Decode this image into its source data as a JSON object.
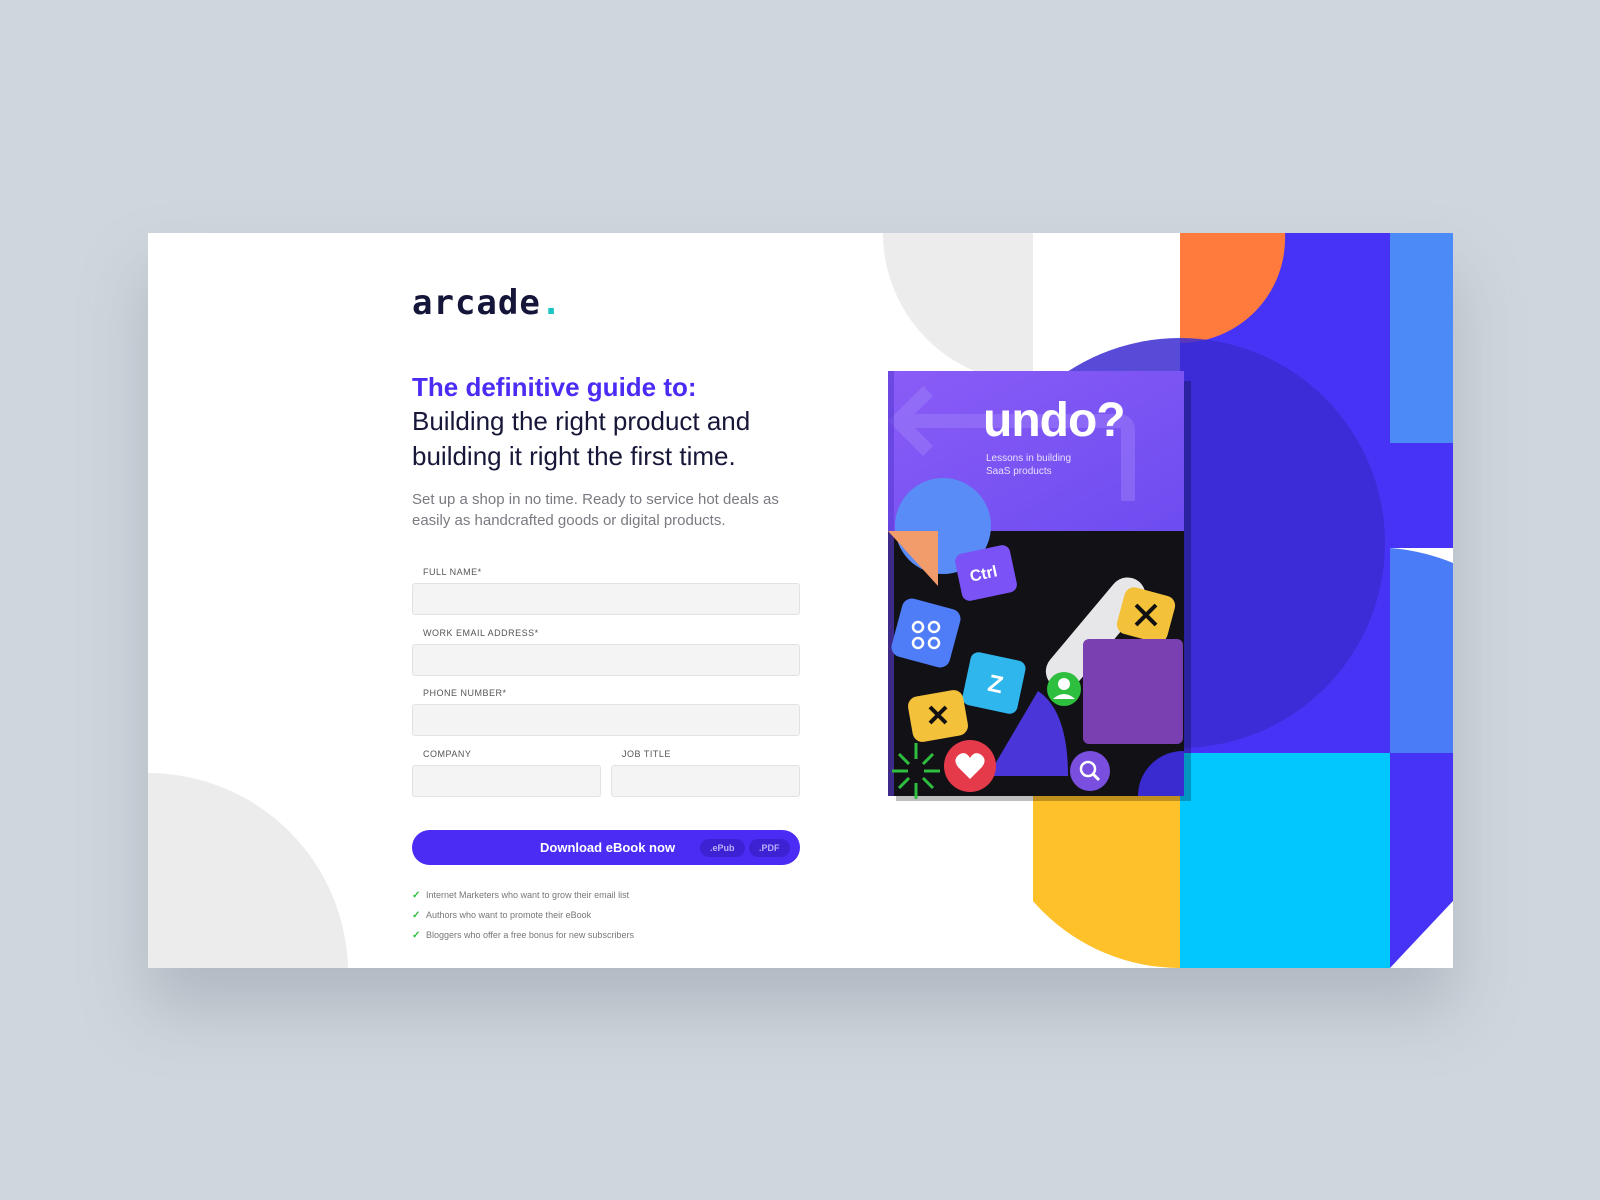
{
  "brand": {
    "logo_text": "ar·cade",
    "logo_main": "arcade",
    "accent": "#4a2cf5",
    "logo_dot_color": "#1cc4c4"
  },
  "hero": {
    "headline_accent": "The definitive guide to:",
    "headline_line1": "Building the right product and",
    "headline_line2": "building it right the first time.",
    "subtext": "Set up a shop in no time. Ready to service hot deals as easily as handcrafted goods or digital products."
  },
  "form": {
    "full_name_label": "FULL NAME*",
    "email_label": "WORK EMAIL ADDRESS*",
    "phone_label": "PHONE NUMBER*",
    "company_label": "COMPANY",
    "job_title_label": "JOB TITLE",
    "full_name_value": "",
    "email_value": "",
    "phone_value": "",
    "company_value": "",
    "job_title_value": ""
  },
  "cta": {
    "download_label": "Download eBook now",
    "format_epub": ".ePub",
    "format_pdf": ".PDF"
  },
  "benefits": [
    "Internet Marketers who want to grow their email list",
    "Authors who want to promote their eBook",
    "Bloggers who offer a free bonus for new subscribers"
  ],
  "book": {
    "title": "undo?",
    "subtitle_line1": "Lessons in building",
    "subtitle_line2": "SaaS products",
    "key_ctrl": "Ctrl",
    "key_z": "Z"
  },
  "icons": {
    "check": "check-icon",
    "heart": "heart-icon",
    "search": "search-icon",
    "command": "command-icon",
    "close": "close-icon",
    "user": "user-icon"
  },
  "colors": {
    "orange": "#ff7a3d",
    "indigo": "#4733f5",
    "blue": "#4a8bf7",
    "cyan": "#00c8ff",
    "yellow": "#ffc12a",
    "purple": "#7a3fb0"
  }
}
